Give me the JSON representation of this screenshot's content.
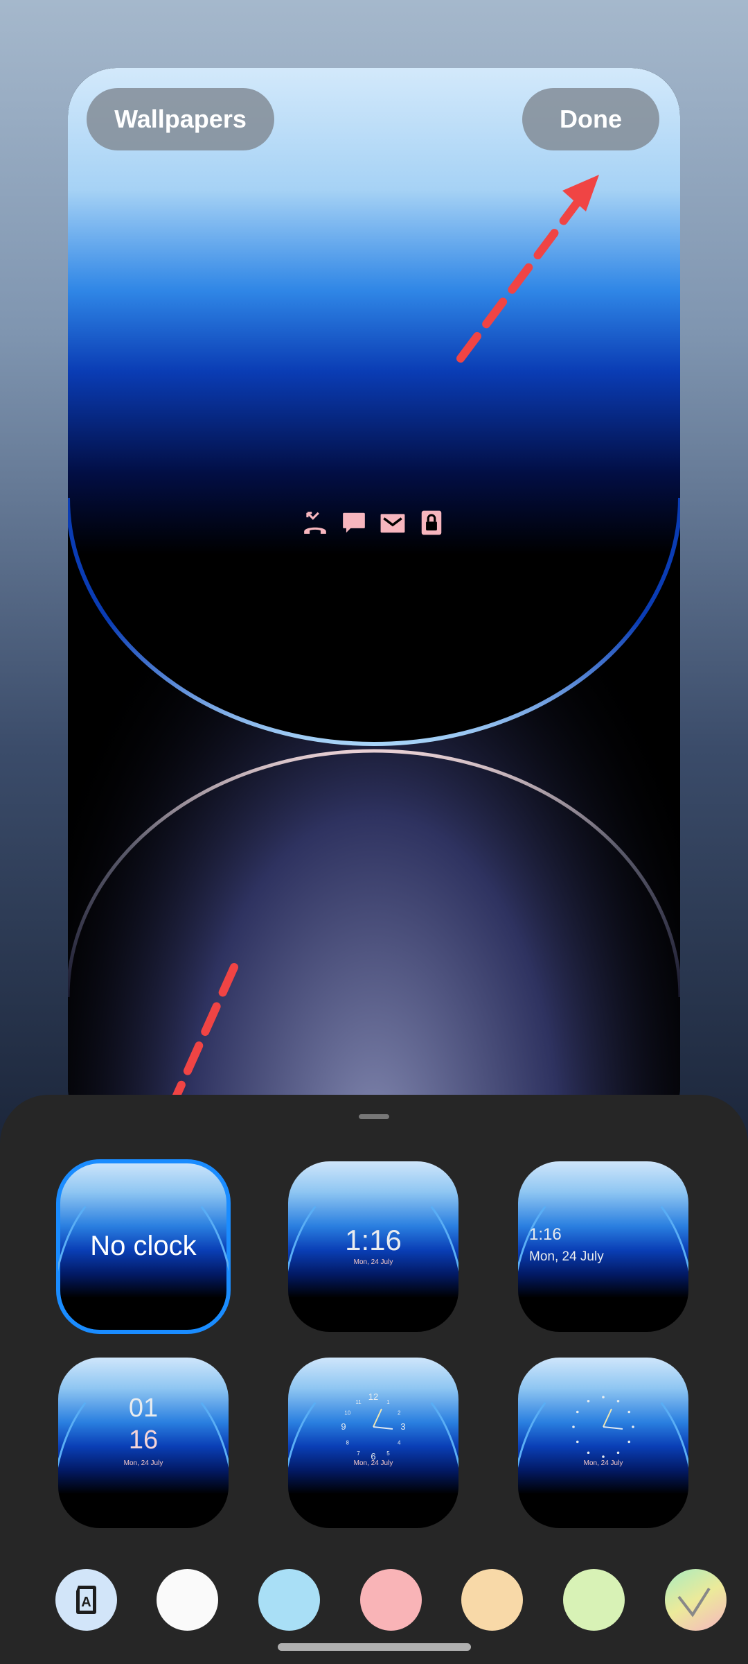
{
  "header": {
    "wallpapers_label": "Wallpapers",
    "done_label": "Done"
  },
  "preview": {
    "notification_icons": [
      "missed-call-icon",
      "message-icon",
      "mail-icon",
      "lock-icon"
    ],
    "icon_color": "#f7b6be"
  },
  "clock_styles": [
    {
      "label": "No clock",
      "selected": true
    },
    {
      "time": "1:16",
      "date": "Mon, 24 July"
    },
    {
      "time": "1:16",
      "date": "Mon, 24 July"
    },
    {
      "hour": "01",
      "minute": "16",
      "date": "Mon, 24 July"
    },
    {
      "numerals": [
        "12",
        "1",
        "2",
        "3",
        "4",
        "5",
        "6",
        "7",
        "8",
        "9",
        "10",
        "11"
      ],
      "date": "Mon, 24 July"
    },
    {
      "date": "Mon, 24 July"
    }
  ],
  "colors": [
    "#fafafa",
    "#a9dff6",
    "#f9b4b7",
    "#f8d9a8",
    "#d8f2b6"
  ],
  "accent": "#1a8cff",
  "annotation_color": "#f04040"
}
